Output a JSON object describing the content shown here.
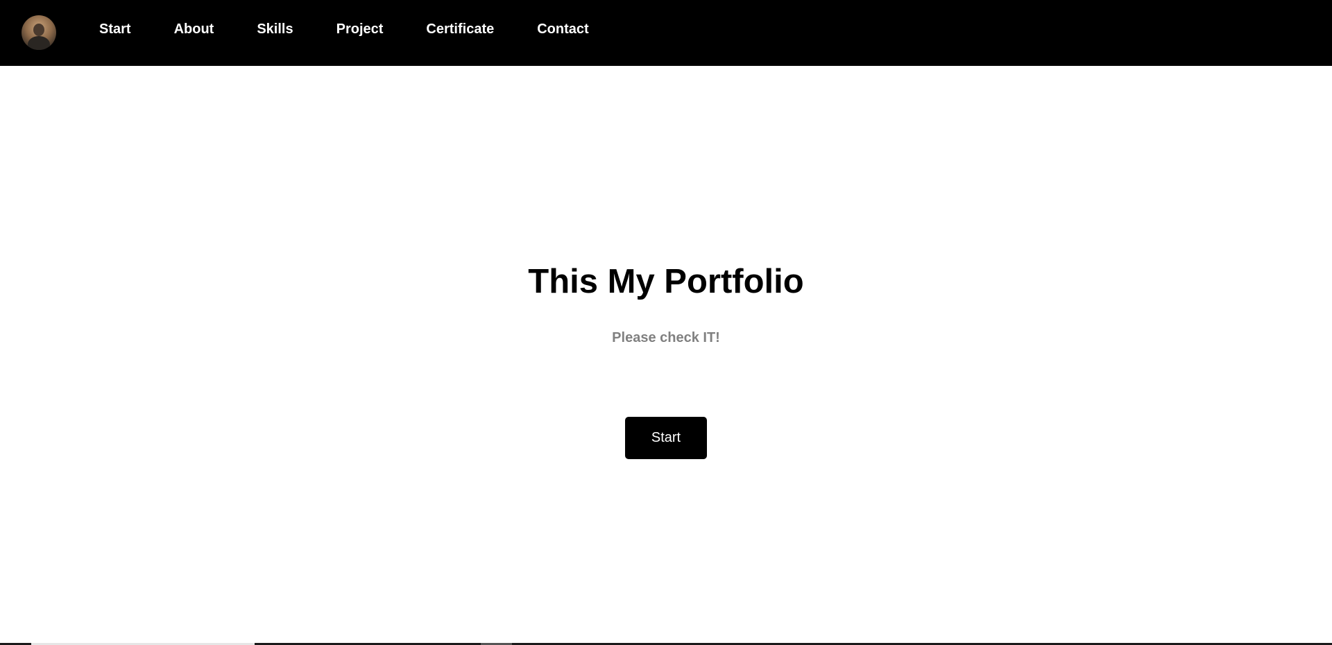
{
  "navbar": {
    "avatar_icon": "profile-photo-avatar",
    "background_color": "#000000",
    "links": [
      {
        "label": "Start"
      },
      {
        "label": "About"
      },
      {
        "label": "Skills"
      },
      {
        "label": "Project"
      },
      {
        "label": "Certificate"
      },
      {
        "label": "Contact"
      }
    ]
  },
  "hero": {
    "title": "This My Portfolio",
    "subtitle": "Please check IT!",
    "button_label": "Start",
    "subtitle_color": "#808080",
    "button_color": "#000000"
  }
}
